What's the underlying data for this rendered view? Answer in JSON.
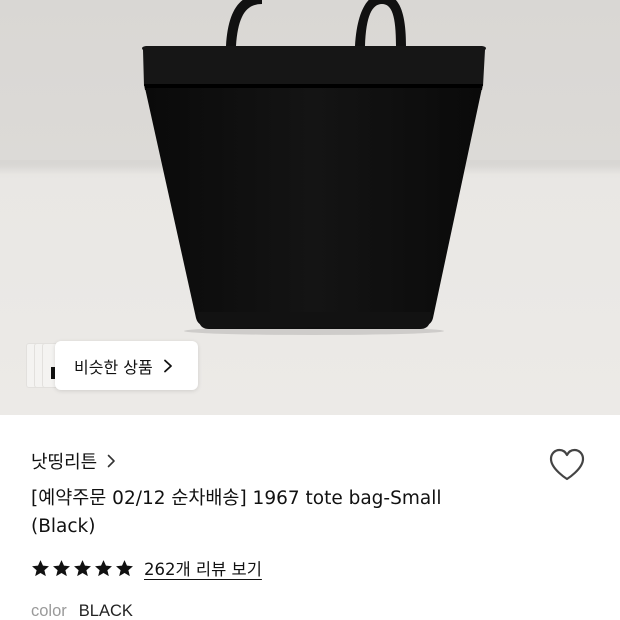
{
  "product_image": {
    "alt_icon": "black-tote-bag-photo"
  },
  "similar": {
    "label": "비슷한 상품"
  },
  "brand": {
    "name": "낫띵리튼"
  },
  "product": {
    "title": "[예약주문 02/12 순차배송] 1967 tote bag-Small (Black)"
  },
  "rating": {
    "stars": 5,
    "review_link": "262개 리뷰 보기"
  },
  "option": {
    "label": "color",
    "value": "BLACK"
  },
  "colors": {
    "star": "#111111",
    "heart_stroke": "#444444",
    "bag": "#0d0d0d"
  }
}
